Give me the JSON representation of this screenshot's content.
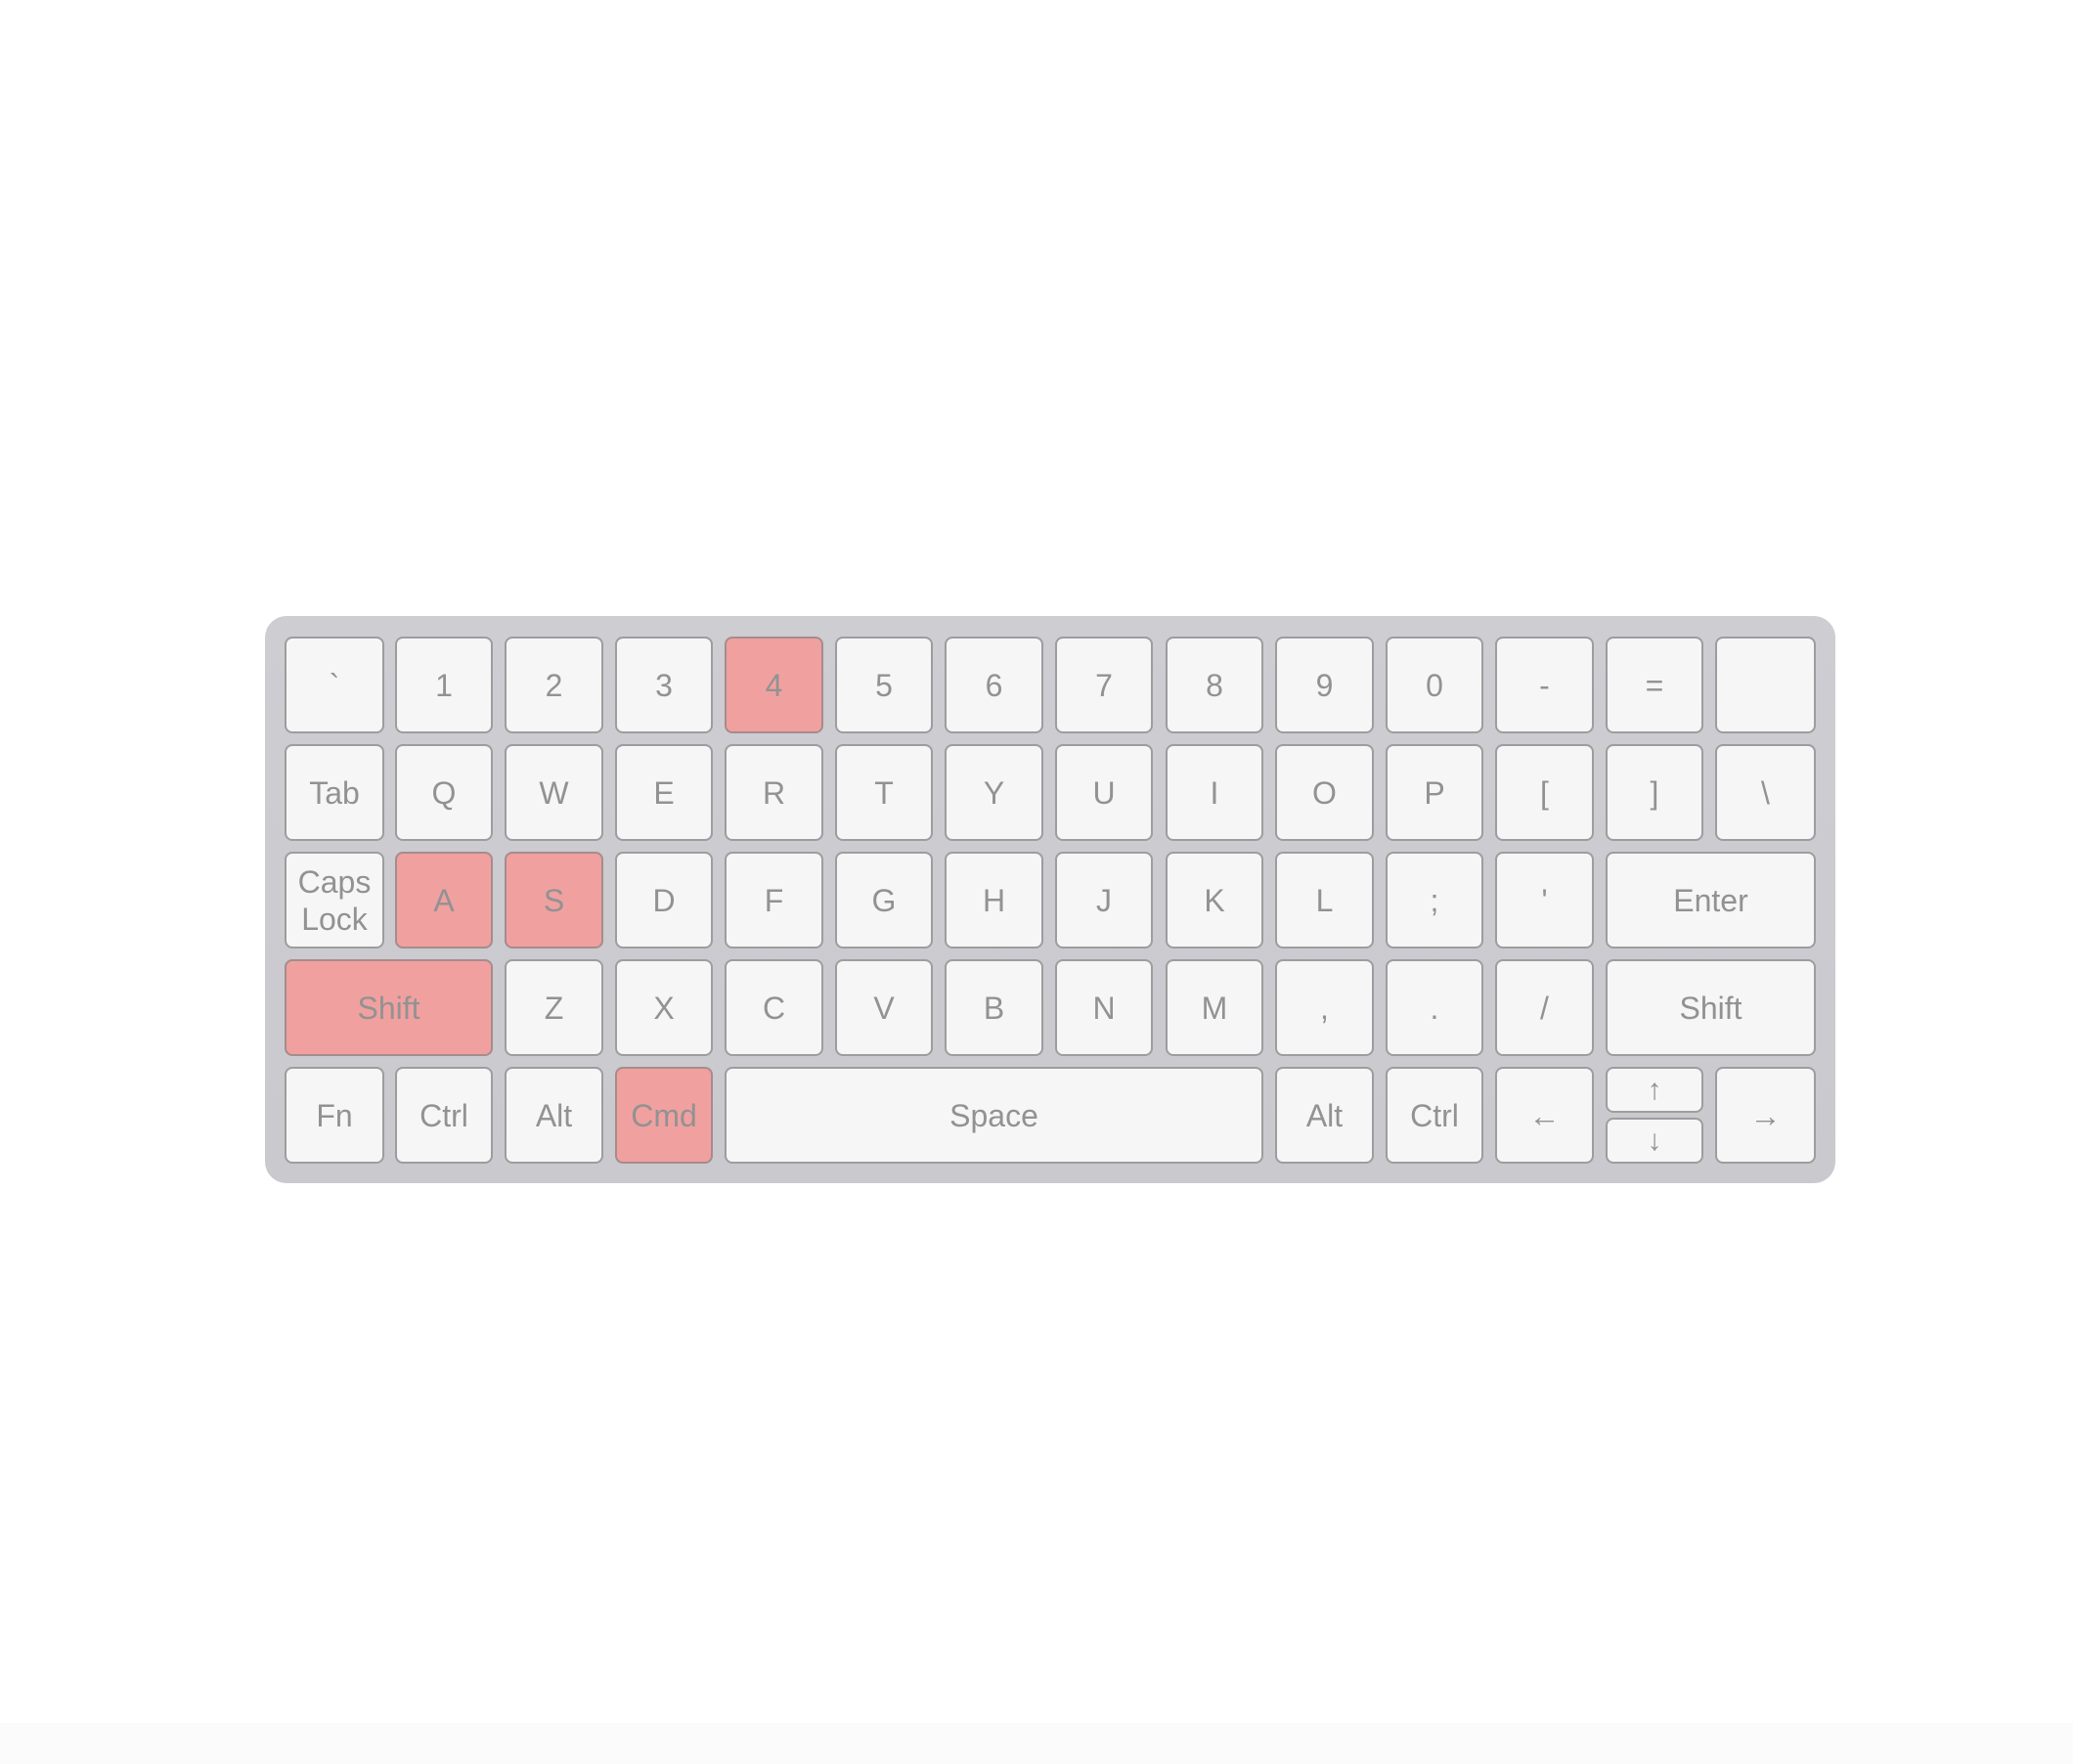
{
  "keyboard": {
    "highlight_color": "#f1a0a0",
    "key_color": "#f6f6f6",
    "frame_color": "#cdcdd2",
    "rows": [
      {
        "name": "number-row",
        "keys": [
          {
            "label": "`",
            "highlighted": false
          },
          {
            "label": "1",
            "highlighted": false
          },
          {
            "label": "2",
            "highlighted": false
          },
          {
            "label": "3",
            "highlighted": false
          },
          {
            "label": "4",
            "highlighted": true
          },
          {
            "label": "5",
            "highlighted": false
          },
          {
            "label": "6",
            "highlighted": false
          },
          {
            "label": "7",
            "highlighted": false
          },
          {
            "label": "8",
            "highlighted": false
          },
          {
            "label": "9",
            "highlighted": false
          },
          {
            "label": "0",
            "highlighted": false
          },
          {
            "label": "-",
            "highlighted": false
          },
          {
            "label": "=",
            "highlighted": false
          },
          {
            "label": "",
            "highlighted": false
          }
        ]
      },
      {
        "name": "top-row",
        "keys": [
          {
            "label": "Tab",
            "highlighted": false
          },
          {
            "label": "Q",
            "highlighted": false
          },
          {
            "label": "W",
            "highlighted": false
          },
          {
            "label": "E",
            "highlighted": false
          },
          {
            "label": "R",
            "highlighted": false
          },
          {
            "label": "T",
            "highlighted": false
          },
          {
            "label": "Y",
            "highlighted": false
          },
          {
            "label": "U",
            "highlighted": false
          },
          {
            "label": "I",
            "highlighted": false
          },
          {
            "label": "O",
            "highlighted": false
          },
          {
            "label": "P",
            "highlighted": false
          },
          {
            "label": "[",
            "highlighted": false
          },
          {
            "label": "]",
            "highlighted": false
          },
          {
            "label": "\\",
            "highlighted": false
          }
        ]
      },
      {
        "name": "home-row",
        "keys": [
          {
            "label_line1": "Caps",
            "label_line2": "Lock",
            "highlighted": false
          },
          {
            "label": "A",
            "highlighted": true
          },
          {
            "label": "S",
            "highlighted": true
          },
          {
            "label": "D",
            "highlighted": false
          },
          {
            "label": "F",
            "highlighted": false
          },
          {
            "label": "G",
            "highlighted": false
          },
          {
            "label": "H",
            "highlighted": false
          },
          {
            "label": "J",
            "highlighted": false
          },
          {
            "label": "K",
            "highlighted": false
          },
          {
            "label": "L",
            "highlighted": false
          },
          {
            "label": ";",
            "highlighted": false
          },
          {
            "label": "'",
            "highlighted": false
          },
          {
            "label": "Enter",
            "highlighted": false
          }
        ]
      },
      {
        "name": "bottom-letter-row",
        "keys": [
          {
            "label": "Shift",
            "highlighted": true
          },
          {
            "label": "Z",
            "highlighted": false
          },
          {
            "label": "X",
            "highlighted": false
          },
          {
            "label": "C",
            "highlighted": false
          },
          {
            "label": "V",
            "highlighted": false
          },
          {
            "label": "B",
            "highlighted": false
          },
          {
            "label": "N",
            "highlighted": false
          },
          {
            "label": "M",
            "highlighted": false
          },
          {
            "label": ",",
            "highlighted": false
          },
          {
            "label": ".",
            "highlighted": false
          },
          {
            "label": "/",
            "highlighted": false
          },
          {
            "label": "Shift",
            "highlighted": false
          }
        ]
      },
      {
        "name": "modifier-row",
        "keys": [
          {
            "label": "Fn",
            "highlighted": false
          },
          {
            "label": "Ctrl",
            "highlighted": false
          },
          {
            "label": "Alt",
            "highlighted": false
          },
          {
            "label": "Cmd",
            "highlighted": true
          },
          {
            "label": "Space",
            "highlighted": false
          },
          {
            "label": "Alt",
            "highlighted": false
          },
          {
            "label": "Ctrl",
            "highlighted": false
          },
          {
            "label": "←",
            "highlighted": false
          },
          {
            "label_up": "↑",
            "label_down": "↓",
            "highlighted": false
          },
          {
            "label": "→",
            "highlighted": false
          }
        ]
      }
    ]
  }
}
